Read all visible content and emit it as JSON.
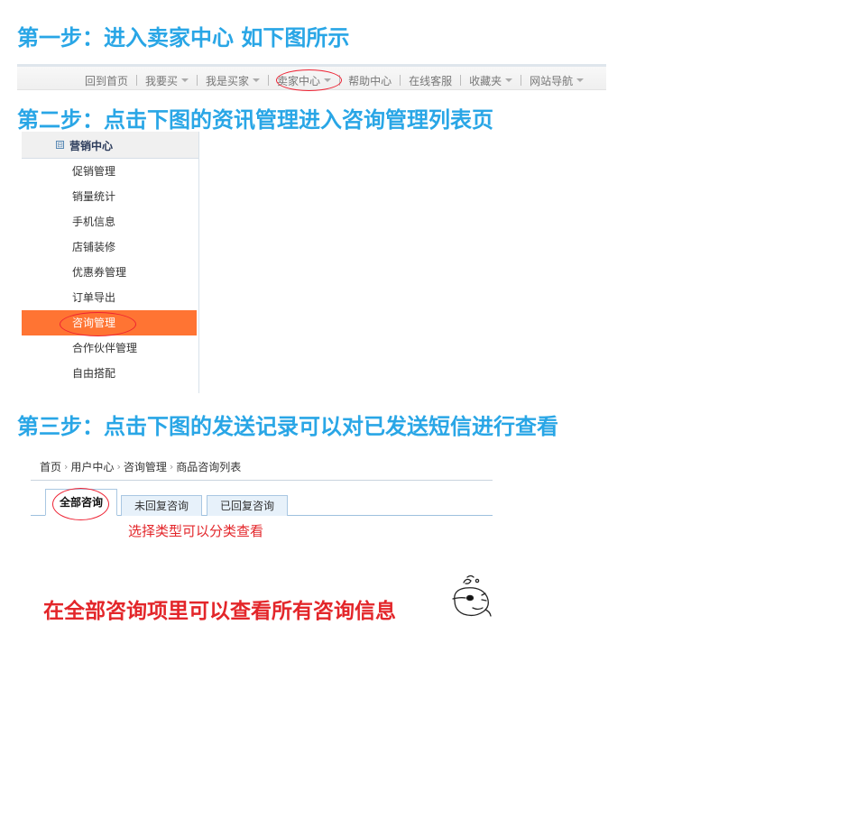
{
  "steps": {
    "step1_title": "第一步：进入卖家中心 如下图所示",
    "step2_title": "第二步：点击下图的资讯管理进入咨询管理列表页",
    "step3_title": "第三步：点击下图的发送记录可以对已发送短信进行查看"
  },
  "topnav": {
    "items": [
      {
        "label": "回到首页",
        "dropdown": false
      },
      {
        "label": "我要买",
        "dropdown": true
      },
      {
        "label": "我是买家",
        "dropdown": true
      },
      {
        "label": "卖家中心",
        "dropdown": true
      },
      {
        "label": "帮助中心",
        "dropdown": false
      },
      {
        "label": "在线客服",
        "dropdown": false
      },
      {
        "label": "收藏夹",
        "dropdown": true
      },
      {
        "label": "网站导航",
        "dropdown": true
      }
    ]
  },
  "sidebar": {
    "section_toggle": "⊟",
    "section_title": "营销中心",
    "items": [
      "促销管理",
      "销量统计",
      "手机信息",
      "店铺装修",
      "优惠券管理",
      "订单导出",
      "咨询管理",
      "合作伙伴管理",
      "自由搭配"
    ],
    "active_index": 6
  },
  "panel": {
    "breadcrumb": [
      "首页",
      "用户中心",
      "咨询管理",
      "商品咨询列表"
    ],
    "breadcrumb_sep": "›",
    "tabs": [
      "全部咨询",
      "未回复咨询",
      "已回复咨询"
    ],
    "active_tab": 0
  },
  "annotations": {
    "select_type_hint": "选择类型可以分类查看",
    "all_consult_hint": "在全部咨询项里可以查看所有咨询信息"
  },
  "colors": {
    "step_title": "#29a6e6",
    "active_sidebar": "#ff7433",
    "annotation_red": "#e3262a"
  },
  "icons": {
    "mascot": "thinking-cartoon-face-icon"
  }
}
